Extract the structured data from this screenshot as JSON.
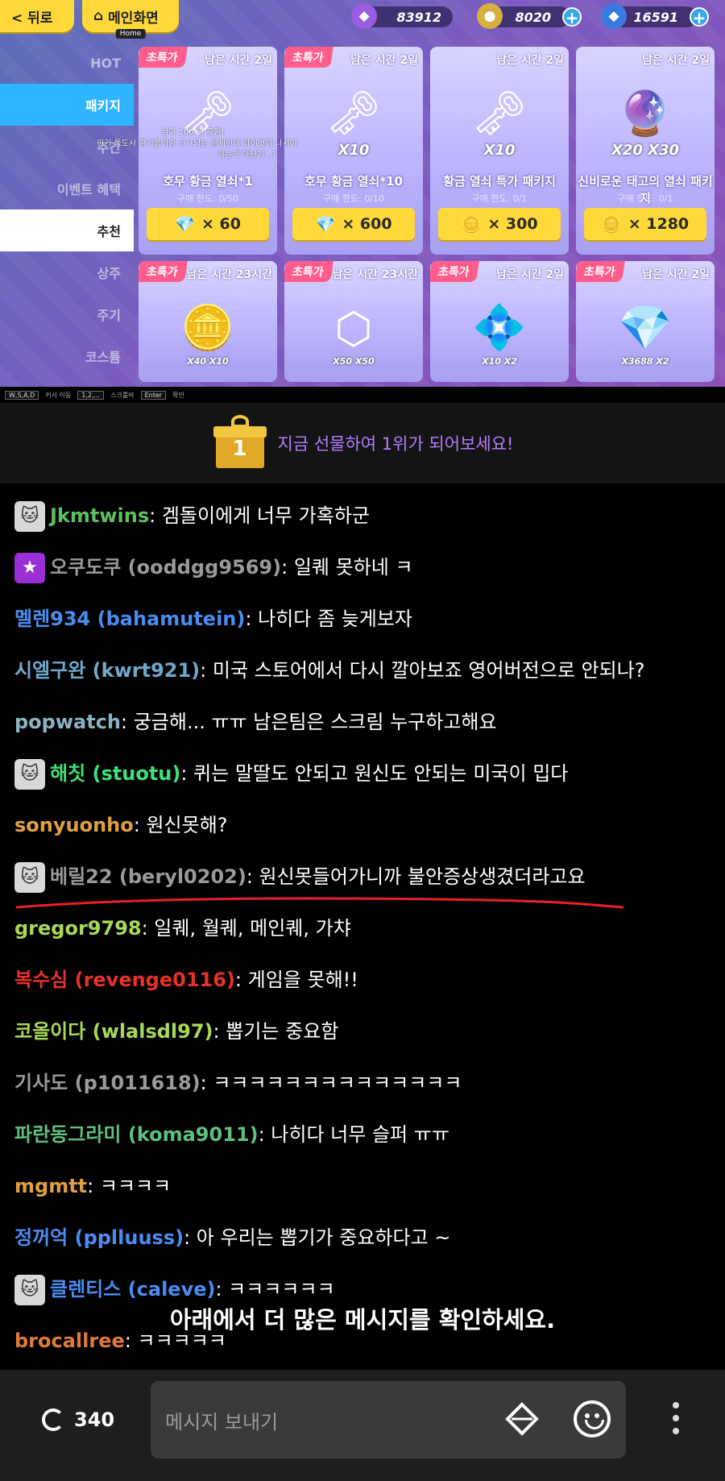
{
  "game": {
    "back_label": "< 뒤로",
    "home_label": "메인화면",
    "home_sub": "Home",
    "currencies": [
      {
        "icon": "purple-gem-icon",
        "value": "83912"
      },
      {
        "icon": "gold-coin-icon",
        "value": "8020"
      },
      {
        "icon": "blue-crystal-icon",
        "value": "16591"
      }
    ],
    "menu": [
      {
        "label": "HOT"
      },
      {
        "label": "패키지"
      },
      {
        "label": "주간"
      },
      {
        "label": "이벤트 혜택"
      },
      {
        "label": "추천"
      },
      {
        "label": "상주"
      },
      {
        "label": "주기"
      },
      {
        "label": "코스튬"
      }
    ],
    "overlay_lines": [
      "님이 100 일 후원!",
      "이거 툴도사 경기품이랑 고ㅋ되는 문제인데 라이엇이 나서야",
      "하는거 아닌가...?"
    ],
    "cards": [
      {
        "badge": "초특가",
        "timer": "남은 시간 2일",
        "art": "🗝",
        "multiplier": "",
        "name": "호무 황금 열쇠*1",
        "limit": "구매 한도: 0/50",
        "price_icon": "💎",
        "price": "× 60"
      },
      {
        "badge": "초특가",
        "timer": "남은 시간 2일",
        "art": "🗝",
        "multiplier": "X10",
        "name": "호무 황금 열쇠*10",
        "limit": "구매 한도: 0/10",
        "price_icon": "💎",
        "price": "× 600"
      },
      {
        "badge": "",
        "timer": "남은 시간 2일",
        "art": "🗝",
        "multiplier": "X10",
        "name": "황금 열쇠 특가 패키지",
        "limit": "구매 한도: 0/1",
        "price_icon": "🪙",
        "price": "× 300"
      },
      {
        "badge": "",
        "timer": "남은 시간 2일",
        "art": "🔮",
        "multiplier": "X20  X30",
        "name": "신비로운 태고의 열쇠 패키지",
        "limit": "구매 한도: 0/1",
        "price_icon": "🪙",
        "price": "× 1280"
      },
      {
        "badge": "초특가",
        "timer": "남은 시간 23시간",
        "art": "🪙",
        "multiplier": "X40  X10",
        "name": "",
        "limit": "",
        "price_icon": "",
        "price": ""
      },
      {
        "badge": "초특가",
        "timer": "남은 시간 23시간",
        "art": "⬡",
        "multiplier": "X50  X50",
        "name": "",
        "limit": "",
        "price_icon": "",
        "price": ""
      },
      {
        "badge": "초특가",
        "timer": "남은 시간 2일",
        "art": "💠",
        "multiplier": "X10  X2",
        "name": "",
        "limit": "",
        "price_icon": "",
        "price": ""
      },
      {
        "badge": "초특가",
        "timer": "남은 시간 2일",
        "art": "💎",
        "multiplier": "X3688  X2",
        "name": "",
        "limit": "",
        "price_icon": "",
        "price": ""
      }
    ],
    "key_hints": [
      {
        "key": "W,S,A,D",
        "desc": "커서 이동"
      },
      {
        "key": "1,2,...",
        "desc": "스크롤바"
      },
      {
        "key": "Enter",
        "desc": "확인"
      }
    ]
  },
  "gift_banner": {
    "rank": "1",
    "text": "지금 선물하여 1위가 되어보세요!"
  },
  "chat": {
    "messages": [
      {
        "avatar": "cat-avatar",
        "avatar_glyph": "🐱",
        "nick": "Jkmtwins",
        "color": "#5fbf5f",
        "text": ": 겜돌이에게 너무 가혹하군"
      },
      {
        "avatar": "star-avatar",
        "avatar_glyph": "★",
        "nick": "오쿠도쿠 (ooddgg9569)",
        "color": "#9a9a9a",
        "text": ": 일퀘 못하네 ㅋ"
      },
      {
        "avatar": "",
        "avatar_glyph": "",
        "nick": "멜렌934 (bahamutein)",
        "color": "#4a8cf0",
        "text": ": 나히다 좀 늦게보자"
      },
      {
        "avatar": "",
        "avatar_glyph": "",
        "nick": "시엘구완 (kwrt921)",
        "color": "#6fa8c8",
        "text": ": 미국 스토어에서 다시 깔아보죠 영어버전으로 안되나?"
      },
      {
        "avatar": "",
        "avatar_glyph": "",
        "nick": "popwatch",
        "color": "#8ab4c4",
        "text": ": 궁금해... ㅠㅠ 남은팀은 스크림 누구하고해요"
      },
      {
        "avatar": "cat-avatar",
        "avatar_glyph": "🐱",
        "nick": "해칫 (stuotu)",
        "color": "#3de07a",
        "text": ": 퀴는 말딸도 안되고 원신도 안되는 미국이 밉다"
      },
      {
        "avatar": "",
        "avatar_glyph": "",
        "nick": "sonyuonho",
        "color": "#e0a040",
        "text": ": 원신못해?"
      },
      {
        "avatar": "cat-avatar",
        "avatar_glyph": "🐱",
        "nick": "베릴22 (beryl0202)",
        "color": "#9a9a9a",
        "text": ": 원신못들어가니까 불안증상생겼더라고요"
      },
      {
        "avatar": "",
        "avatar_glyph": "",
        "nick": "gregor9798",
        "color": "#a8d85a",
        "text": ": 일퀘, 월퀘, 메인퀘, 가챠"
      },
      {
        "avatar": "",
        "avatar_glyph": "",
        "nick": "복수심 (revenge0116)",
        "color": "#e8302a",
        "text": ": 게임을 못해!!"
      },
      {
        "avatar": "",
        "avatar_glyph": "",
        "nick": "코올이다 (wlalsdl97)",
        "color": "#a8d85a",
        "text": ": 뽑기는 중요함"
      },
      {
        "avatar": "",
        "avatar_glyph": "",
        "nick": "기사도 (p1011618)",
        "color": "#9a9a9a",
        "text": ": ㅋㅋㅋㅋㅋㅋㅋㅋㅋㅋㅋㅋㅋㅋ"
      },
      {
        "avatar": "",
        "avatar_glyph": "",
        "nick": "파란동그라미 (koma9011)",
        "color": "#5fbf7f",
        "text": ": 나히다 너무 슬퍼 ㅠㅠ"
      },
      {
        "avatar": "",
        "avatar_glyph": "",
        "nick": "mgmtt",
        "color": "#e0a040",
        "text": ": ㅋㅋㅋㅋ"
      },
      {
        "avatar": "",
        "avatar_glyph": "",
        "nick": "정꺼억 (pplluuss)",
        "color": "#4a8cf0",
        "text": ": 아 우리는 뽑기가 중요하다고 ~"
      },
      {
        "avatar": "cat-avatar",
        "avatar_glyph": "🐱",
        "nick": "클렌티스 (caleve)",
        "color": "#4a8cf0",
        "text": ": ㅋㅋㅋㅋㅋㅋ"
      },
      {
        "avatar": "",
        "avatar_glyph": "",
        "nick": "brocallree",
        "color": "#e07a3a",
        "text": ": ㅋㅋㅋㅋㅋ"
      }
    ],
    "notice": "아래에서 더 많은 메시지를 확인하세요."
  },
  "bottom_bar": {
    "viewer_count": "340",
    "input_placeholder": "메시지 보내기"
  }
}
